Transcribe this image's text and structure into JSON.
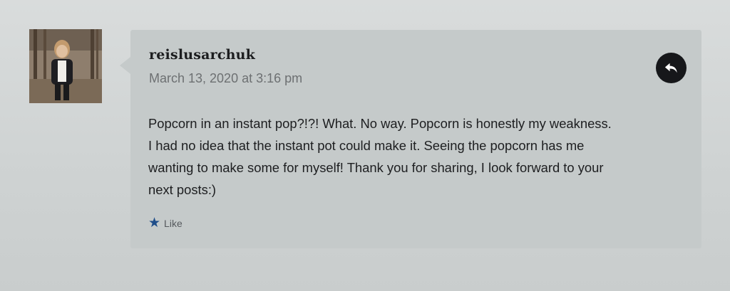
{
  "comment": {
    "author": "reislusarchuk",
    "timestamp": "March 13, 2020 at 3:16 pm",
    "text": "Popcorn in an instant pop?!?! What. No way. Popcorn is honestly my weakness.\nI had no idea that the instant pot could make it. Seeing the popcorn has me\nwanting to make some for myself! Thank you for sharing, I look forward to your\nnext posts:)",
    "like_label": "Like",
    "like_icon": "star-icon",
    "reply_icon": "reply-arrow-icon",
    "avatar": "user-avatar-photo"
  },
  "colors": {
    "reply_button": "#16171a",
    "like_star": "#1f4e8a",
    "comment_background": "#c5caca"
  }
}
